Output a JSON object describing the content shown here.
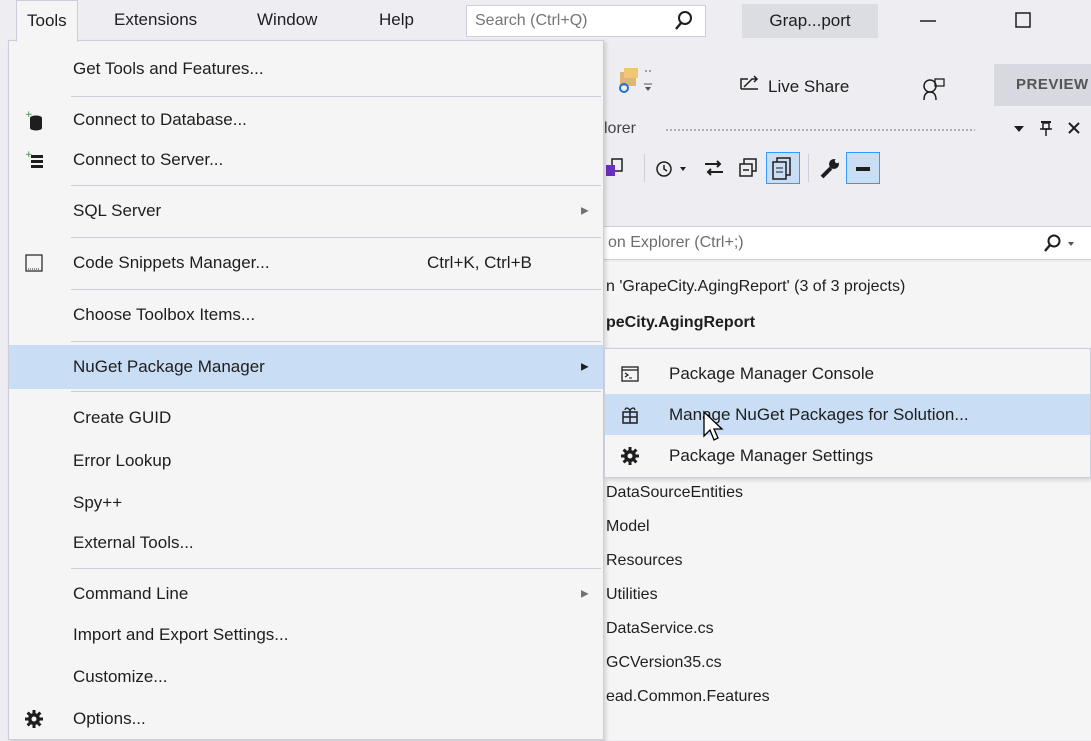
{
  "menubar": {
    "items": [
      "Tools",
      "Extensions",
      "Window",
      "Help"
    ],
    "search_placeholder": "Search (Ctrl+Q)",
    "window_title": "Grap...port",
    "minimize_icon": "minimize-icon",
    "maximize_icon": "maximize-icon"
  },
  "toolbar": {
    "live_share_label": "Live Share",
    "preview_label": "PREVIEW"
  },
  "solution_explorer": {
    "title": "lorer",
    "search_text": "on Explorer (Ctrl+;)",
    "tree": [
      "n 'GrapeCity.AgingReport' (3 of 3 projects)",
      "peCity.AgingReport",
      "DataSourceEntities",
      "Model",
      "Resources",
      "Utilities",
      "DataService.cs",
      "GCVersion35.cs",
      "ead.Common.Features"
    ]
  },
  "tools_menu": {
    "items": [
      {
        "label": "Get Tools and Features...",
        "icon": "",
        "shortcut": "",
        "submenu": false
      },
      {
        "label": "Connect to Database...",
        "icon": "database-icon",
        "shortcut": "",
        "submenu": false
      },
      {
        "label": "Connect to Server...",
        "icon": "server-icon",
        "shortcut": "",
        "submenu": false
      },
      {
        "label": "SQL Server",
        "icon": "",
        "shortcut": "",
        "submenu": true
      },
      {
        "label": "Code Snippets Manager...",
        "icon": "snippet-icon",
        "shortcut": "Ctrl+K, Ctrl+B",
        "submenu": false
      },
      {
        "label": "Choose Toolbox Items...",
        "icon": "",
        "shortcut": "",
        "submenu": false
      },
      {
        "label": "NuGet Package Manager",
        "icon": "",
        "shortcut": "",
        "submenu": true
      },
      {
        "label": "Create GUID",
        "icon": "",
        "shortcut": "",
        "submenu": false
      },
      {
        "label": "Error Lookup",
        "icon": "",
        "shortcut": "",
        "submenu": false
      },
      {
        "label": "Spy++",
        "icon": "",
        "shortcut": "",
        "submenu": false
      },
      {
        "label": "External Tools...",
        "icon": "",
        "shortcut": "",
        "submenu": false
      },
      {
        "label": "Command Line",
        "icon": "",
        "shortcut": "",
        "submenu": true
      },
      {
        "label": "Import and Export Settings...",
        "icon": "",
        "shortcut": "",
        "submenu": false
      },
      {
        "label": "Customize...",
        "icon": "",
        "shortcut": "",
        "submenu": false
      },
      {
        "label": "Options...",
        "icon": "gear-icon",
        "shortcut": "",
        "submenu": false
      }
    ]
  },
  "nuget_submenu": {
    "items": [
      {
        "label": "Package Manager Console",
        "icon": "console-icon"
      },
      {
        "label": "Manage NuGet Packages for Solution...",
        "icon": "package-icon"
      },
      {
        "label": "Package Manager Settings",
        "icon": "gear-icon"
      }
    ]
  },
  "colors": {
    "menu_bg": "#f5f5f5",
    "highlight": "#c9def5",
    "chrome": "#eeeef2",
    "border": "#cccedb"
  }
}
